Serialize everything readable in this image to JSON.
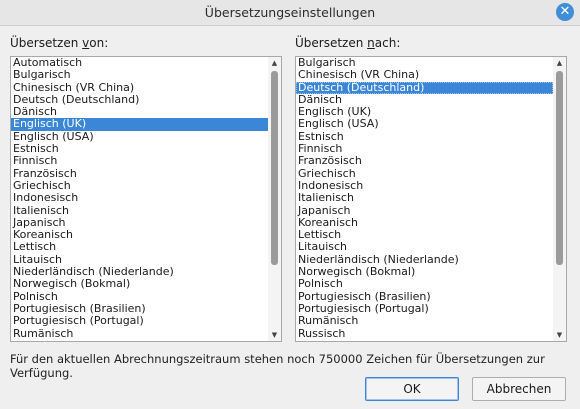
{
  "window": {
    "title": "Übersetzungseinstellungen",
    "close_glyph": "✕"
  },
  "from": {
    "label_pre": "Übersetzen ",
    "label_accel": "v",
    "label_post": "on:",
    "items": [
      "Automatisch",
      "Bulgarisch",
      "Chinesisch (VR China)",
      "Deutsch (Deutschland)",
      "Dänisch",
      "Englisch (UK)",
      "Englisch (USA)",
      "Estnisch",
      "Finnisch",
      "Französisch",
      "Griechisch",
      "Indonesisch",
      "Italienisch",
      "Japanisch",
      "Koreanisch",
      "Lettisch",
      "Litauisch",
      "Niederländisch (Niederlande)",
      "Norwegisch (Bokmal)",
      "Polnisch",
      "Portugiesisch (Brasilien)",
      "Portugiesisch (Portugal)",
      "Rumänisch"
    ],
    "selected": "Englisch (UK)"
  },
  "to": {
    "label_pre": "Übersetzen ",
    "label_accel": "n",
    "label_post": "ach:",
    "items": [
      "Bulgarisch",
      "Chinesisch (VR China)",
      "Deutsch (Deutschland)",
      "Dänisch",
      "Englisch (UK)",
      "Englisch (USA)",
      "Estnisch",
      "Finnisch",
      "Französisch",
      "Griechisch",
      "Indonesisch",
      "Italienisch",
      "Japanisch",
      "Koreanisch",
      "Lettisch",
      "Litauisch",
      "Niederländisch (Niederlande)",
      "Norwegisch (Bokmal)",
      "Polnisch",
      "Portugiesisch (Brasilien)",
      "Portugiesisch (Portugal)",
      "Rumänisch",
      "Russisch"
    ],
    "selected": "Deutsch (Deutschland)"
  },
  "status_text": "Für den aktuellen Abrechnungszeitraum stehen noch 750000 Zeichen für Übersetzungen zur Verfügung.",
  "buttons": {
    "ok": "OK",
    "cancel": "Abbrechen"
  },
  "colors": {
    "selection": "#3b86d6",
    "accent": "#3f8fd8"
  }
}
